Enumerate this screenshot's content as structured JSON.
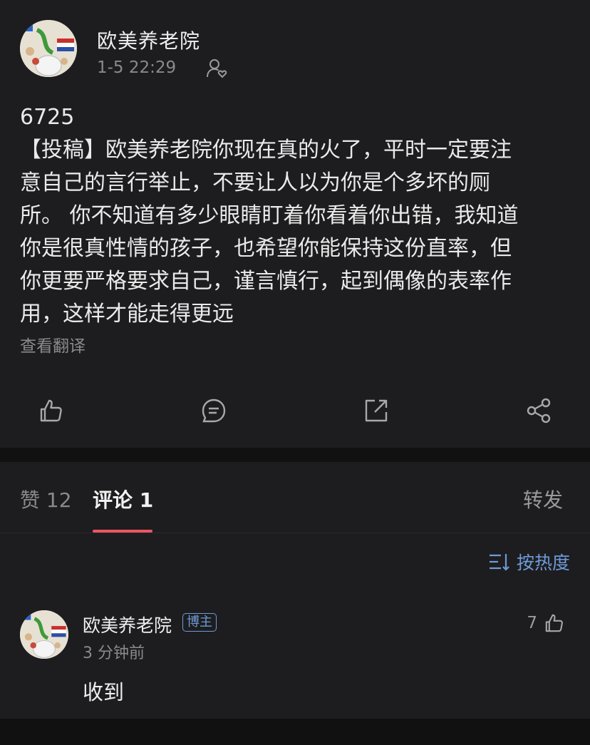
{
  "post": {
    "author": "欧美养老院",
    "time": "1-5 22:29",
    "lines": [
      "6725",
      "【投稿】欧美养老院你现在真的火了，平时一定要注",
      "意自己的言行举止，不要让人以为你是个多坏的厕",
      "所。 你不知道有多少眼睛盯着你看着你出错，我知道",
      "你是很真性情的孩子，也希望你能保持这份直率，但",
      "你更要严格要求自己，谨言慎行，起到偶像的表率作",
      "用，这样才能走得更远"
    ],
    "translate": "查看翻译"
  },
  "tabs": {
    "likes": "赞 12",
    "comments": "评论 1",
    "reposts": "转发"
  },
  "sort": {
    "label": "按热度"
  },
  "comment": {
    "author": "欧美养老院",
    "badge": "博主",
    "time": "3 分钟前",
    "text": "收到",
    "likes": "7"
  },
  "colors": {
    "background": "#111111",
    "card": "#1d1d1f",
    "accent_red": "#ef5561",
    "link_blue": "#6f9ad8",
    "muted": "#8a8a8e"
  },
  "icons": {
    "avatar": "cartoon-avatar",
    "follow": "user-heart-icon",
    "like": "thumbs-up-icon",
    "comment": "comment-bubble-icon",
    "repost": "repost-arrow-icon",
    "share": "share-nodes-icon",
    "sort": "sort-lines-icon"
  }
}
